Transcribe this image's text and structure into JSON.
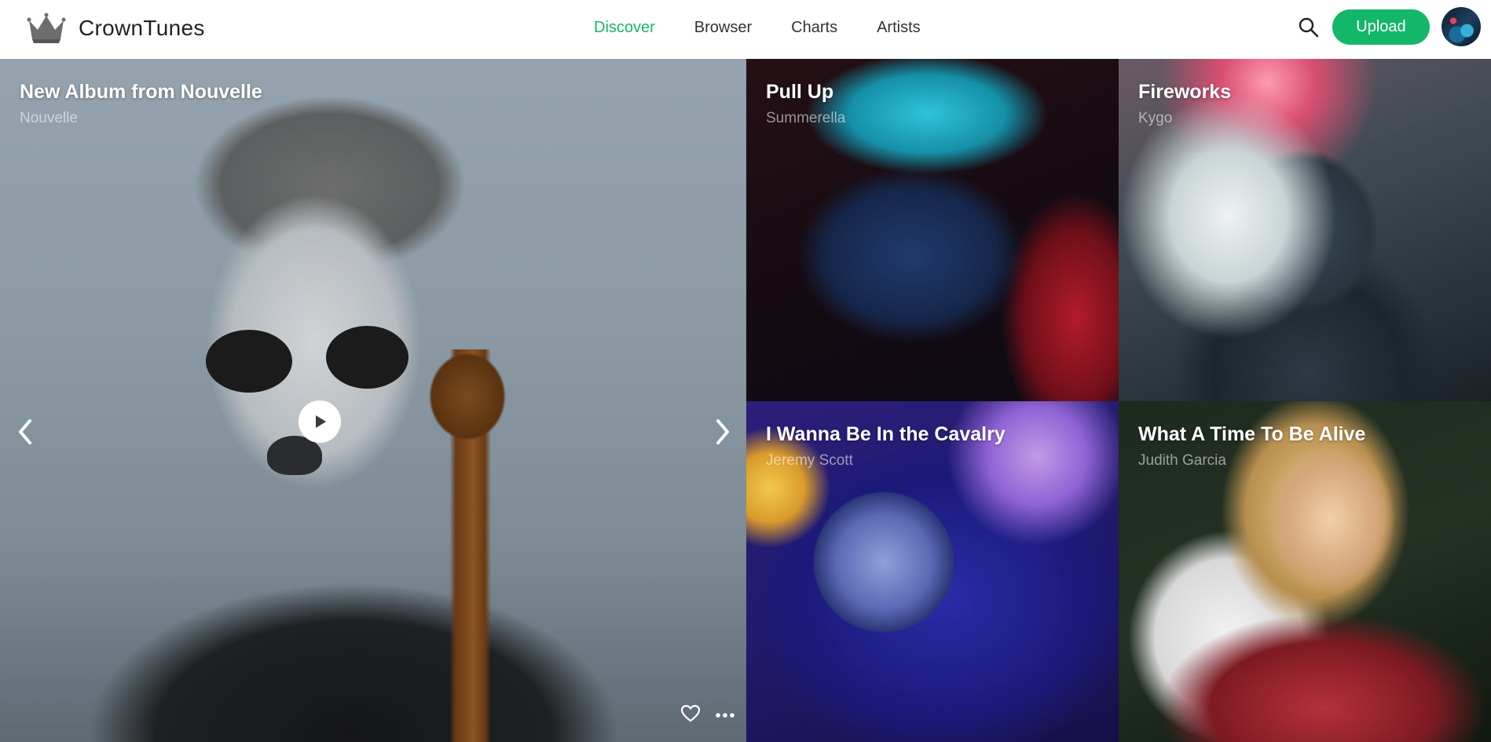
{
  "app": {
    "name": "CrownTunes"
  },
  "nav": {
    "items": [
      "Discover",
      "Browser",
      "Charts",
      "Artists"
    ],
    "active": "Discover"
  },
  "header": {
    "upload_label": "Upload"
  },
  "colors": {
    "accent": "#14b76a"
  },
  "hero": {
    "title": "New Album from Nouvelle",
    "artist": "Nouvelle"
  },
  "tiles": [
    {
      "title": "Pull Up",
      "artist": "Summerella"
    },
    {
      "title": "Fireworks",
      "artist": "Kygo"
    },
    {
      "title": "I Wanna Be In the Cavalry",
      "artist": "Jeremy Scott"
    },
    {
      "title": "What A Time To Be Alive",
      "artist": "Judith Garcia"
    }
  ],
  "icons": [
    "crown-icon",
    "search-icon",
    "play-icon",
    "chevron-left-icon",
    "chevron-right-icon",
    "heart-icon",
    "more-icon"
  ]
}
